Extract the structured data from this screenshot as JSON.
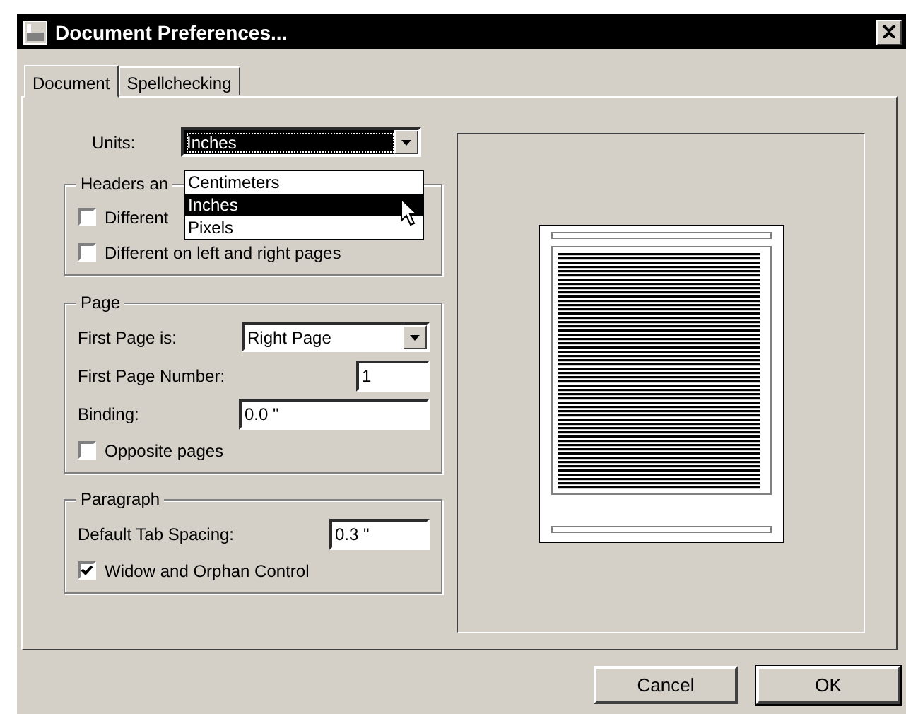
{
  "window": {
    "title": "Document Preferences..."
  },
  "tabs": [
    {
      "label": "Document",
      "selected": true
    },
    {
      "label": "Spellchecking",
      "selected": false
    }
  ],
  "units": {
    "label": "Units:",
    "value": "Inches",
    "expanded": true,
    "options": [
      {
        "label": "Centimeters",
        "selected": false
      },
      {
        "label": "Inches",
        "selected": true
      },
      {
        "label": "Pixels",
        "selected": false
      }
    ]
  },
  "groups": [
    {
      "title": "Headers an",
      "rows": [
        {
          "kind": "checkbox",
          "label": "Different",
          "checked": false
        },
        {
          "kind": "checkbox",
          "label": "Different on left and right pages",
          "checked": false
        }
      ]
    },
    {
      "title": "Page",
      "rows": [
        {
          "kind": "combo",
          "label": "First Page is:",
          "value": "Right Page"
        },
        {
          "kind": "field",
          "label": "First Page Number:",
          "value": "1"
        },
        {
          "kind": "field",
          "label": "Binding:",
          "value": "0.0 \""
        },
        {
          "kind": "checkbox",
          "label": "Opposite pages",
          "checked": false
        }
      ]
    },
    {
      "title": "Paragraph",
      "rows": [
        {
          "kind": "field",
          "label": "Default Tab Spacing:",
          "value": "0.3 \""
        },
        {
          "kind": "checkbox",
          "label": "Widow and Orphan Control",
          "checked": true
        }
      ]
    }
  ],
  "buttons": [
    {
      "label": "Cancel",
      "default": false
    },
    {
      "label": "OK",
      "default": true
    }
  ]
}
